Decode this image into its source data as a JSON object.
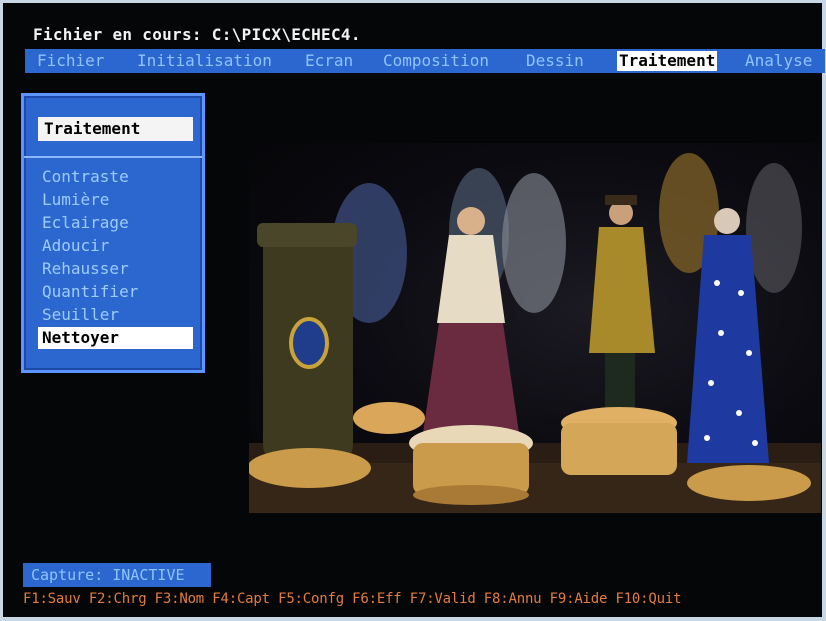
{
  "header": {
    "title": "Fichier en cours: C:\\PICX\\ECHEC4."
  },
  "menubar": {
    "items": [
      {
        "label": "Fichier"
      },
      {
        "label": "Initialisation"
      },
      {
        "label": "Ecran"
      },
      {
        "label": "Composition"
      },
      {
        "label": "Dessin"
      },
      {
        "label": "Traitement",
        "active": true
      },
      {
        "label": "Analyse"
      }
    ]
  },
  "panel": {
    "title": "Traitement",
    "options": [
      {
        "label": "Contraste"
      },
      {
        "label": "Lumière"
      },
      {
        "label": "Eclairage"
      },
      {
        "label": "Adoucir"
      },
      {
        "label": "Rehausser"
      },
      {
        "label": "Quantifier"
      },
      {
        "label": "Seuiller"
      },
      {
        "label": "Nettoyer",
        "selected": true
      }
    ]
  },
  "status": {
    "capture": "Capture: INACTIVE"
  },
  "function_keys": "F1:Sauv F2:Chrg F3:Nom F4:Capt F5:Confg F6:Eff F7:Valid F8:Annu F9:Aide F10:Quit",
  "colors": {
    "menu_bg": "#2c67d0",
    "menu_text": "#8fc3ff",
    "highlight_bg": "#ffffff",
    "fkey_text": "#e37b3e"
  }
}
